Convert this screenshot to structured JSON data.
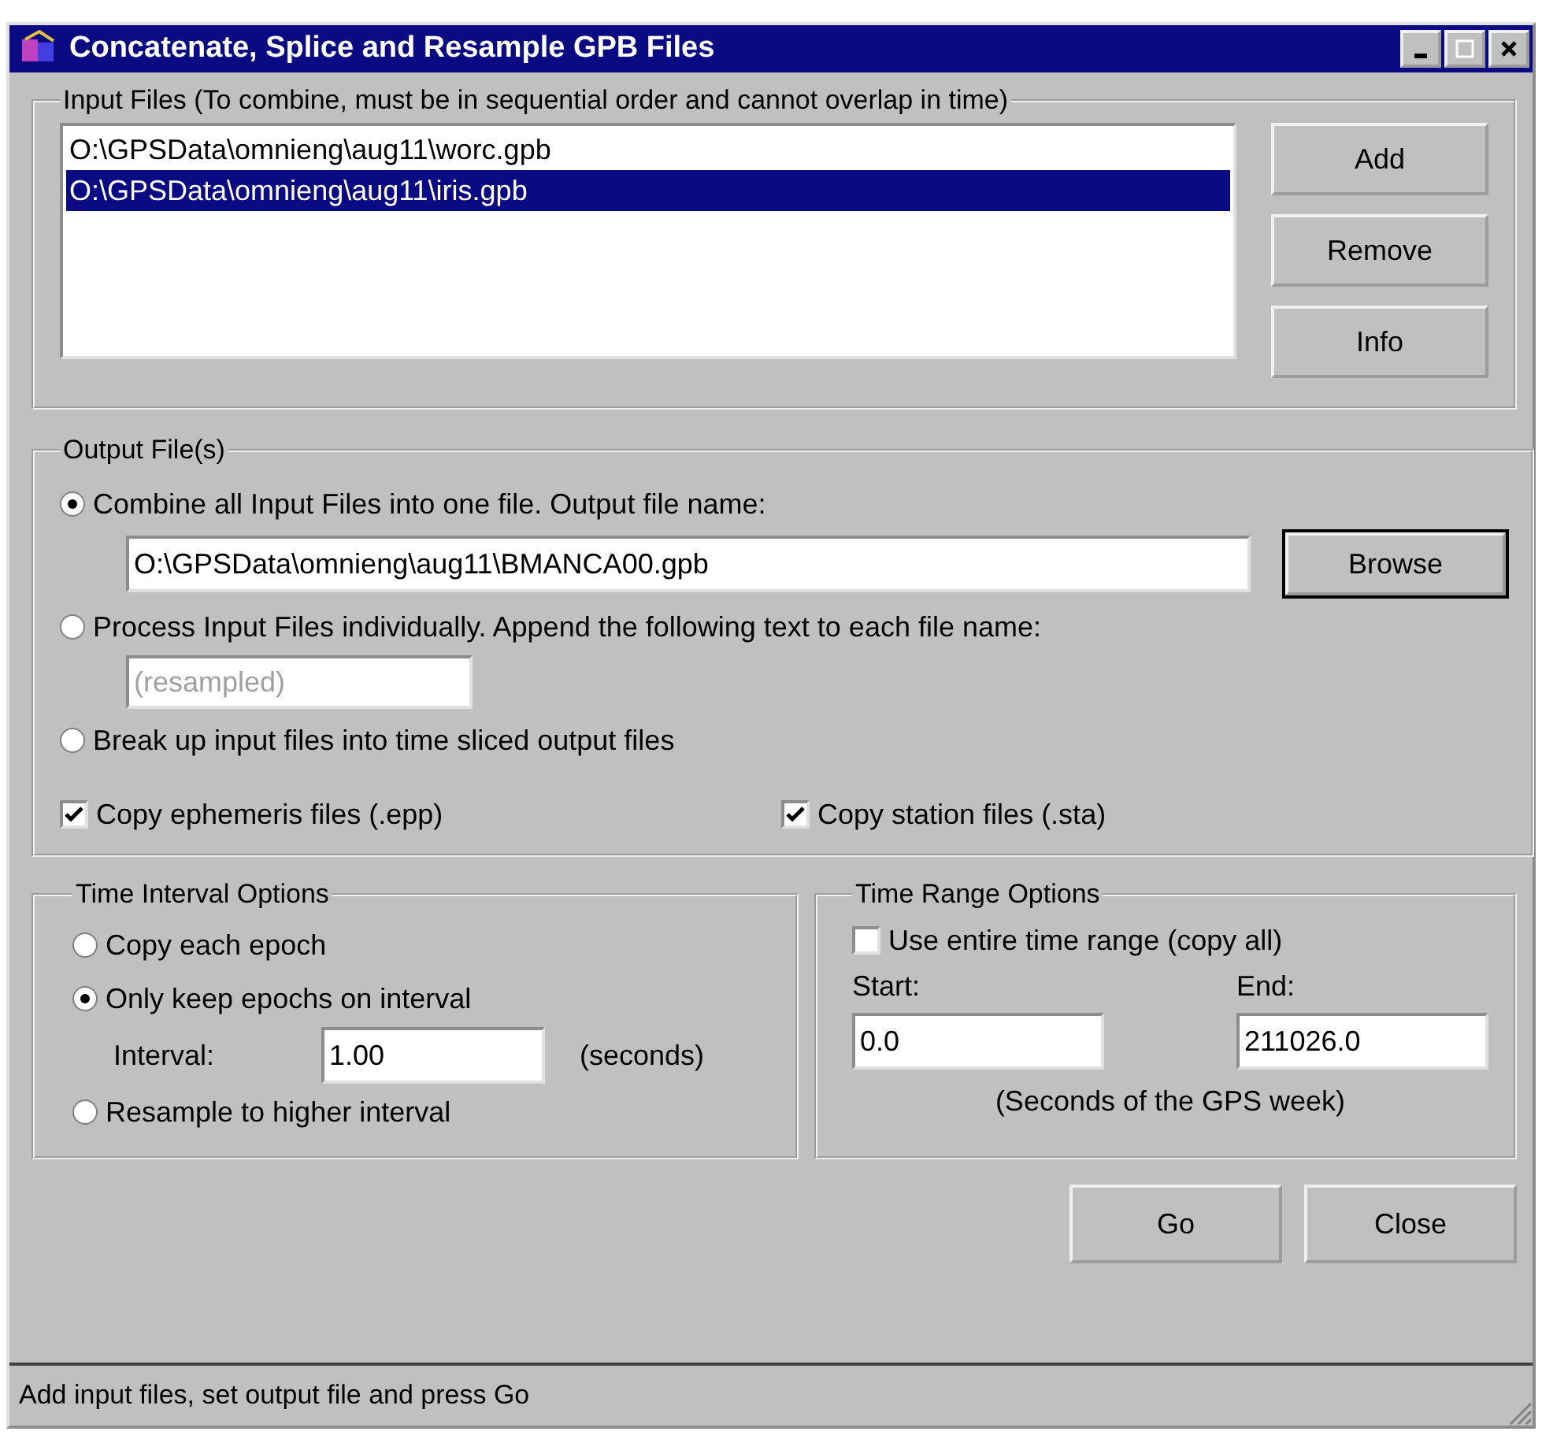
{
  "window": {
    "title": "Concatenate, Splice and Resample GPB Files"
  },
  "input_files": {
    "legend": "Input Files (To combine, must be in sequential order and cannot overlap in time)",
    "items": [
      {
        "label": "O:\\GPSData\\omnieng\\aug11\\worc.gpb",
        "selected": false
      },
      {
        "label": "O:\\GPSData\\omnieng\\aug11\\iris.gpb",
        "selected": true
      }
    ],
    "buttons": [
      "Add",
      "Remove",
      "Info"
    ]
  },
  "output_files": {
    "legend": "Output File(s)",
    "options": [
      {
        "label": "Combine all Input Files into one file. Output file name:",
        "selected": true,
        "field": {
          "value": "O:\\GPSData\\omnieng\\aug11\\BMANCA00.gpb",
          "disabled": false
        },
        "button": "Browse"
      },
      {
        "label": "Process Input Files individually. Append the following text to each file name:",
        "selected": false,
        "field": {
          "value": "(resampled)",
          "disabled": true
        }
      },
      {
        "label": "Break up input files into time sliced output files",
        "selected": false
      }
    ],
    "checkboxes": [
      {
        "label": "Copy ephemeris files (.epp)",
        "checked": true
      },
      {
        "label": "Copy station files (.sta)",
        "checked": true
      }
    ]
  },
  "time_interval": {
    "legend": "Time Interval Options",
    "options": [
      {
        "label": "Copy each epoch",
        "selected": false
      },
      {
        "label": "Only keep epochs on interval",
        "selected": true
      },
      {
        "label": "Resample to higher interval",
        "selected": false
      }
    ],
    "interval_label": "Interval:",
    "interval_value": "1.00",
    "interval_unit": "(seconds)"
  },
  "time_range": {
    "legend": "Time Range Options",
    "use_entire": {
      "label": "Use entire time range (copy all)",
      "checked": false
    },
    "start_label": "Start:",
    "start_value": "0.0",
    "end_label": "End:",
    "end_value": "211026.0",
    "note": "(Seconds of the GPS week)"
  },
  "buttons": [
    "Go",
    "Close"
  ],
  "status_bar": "Add input files, set output file and press Go"
}
